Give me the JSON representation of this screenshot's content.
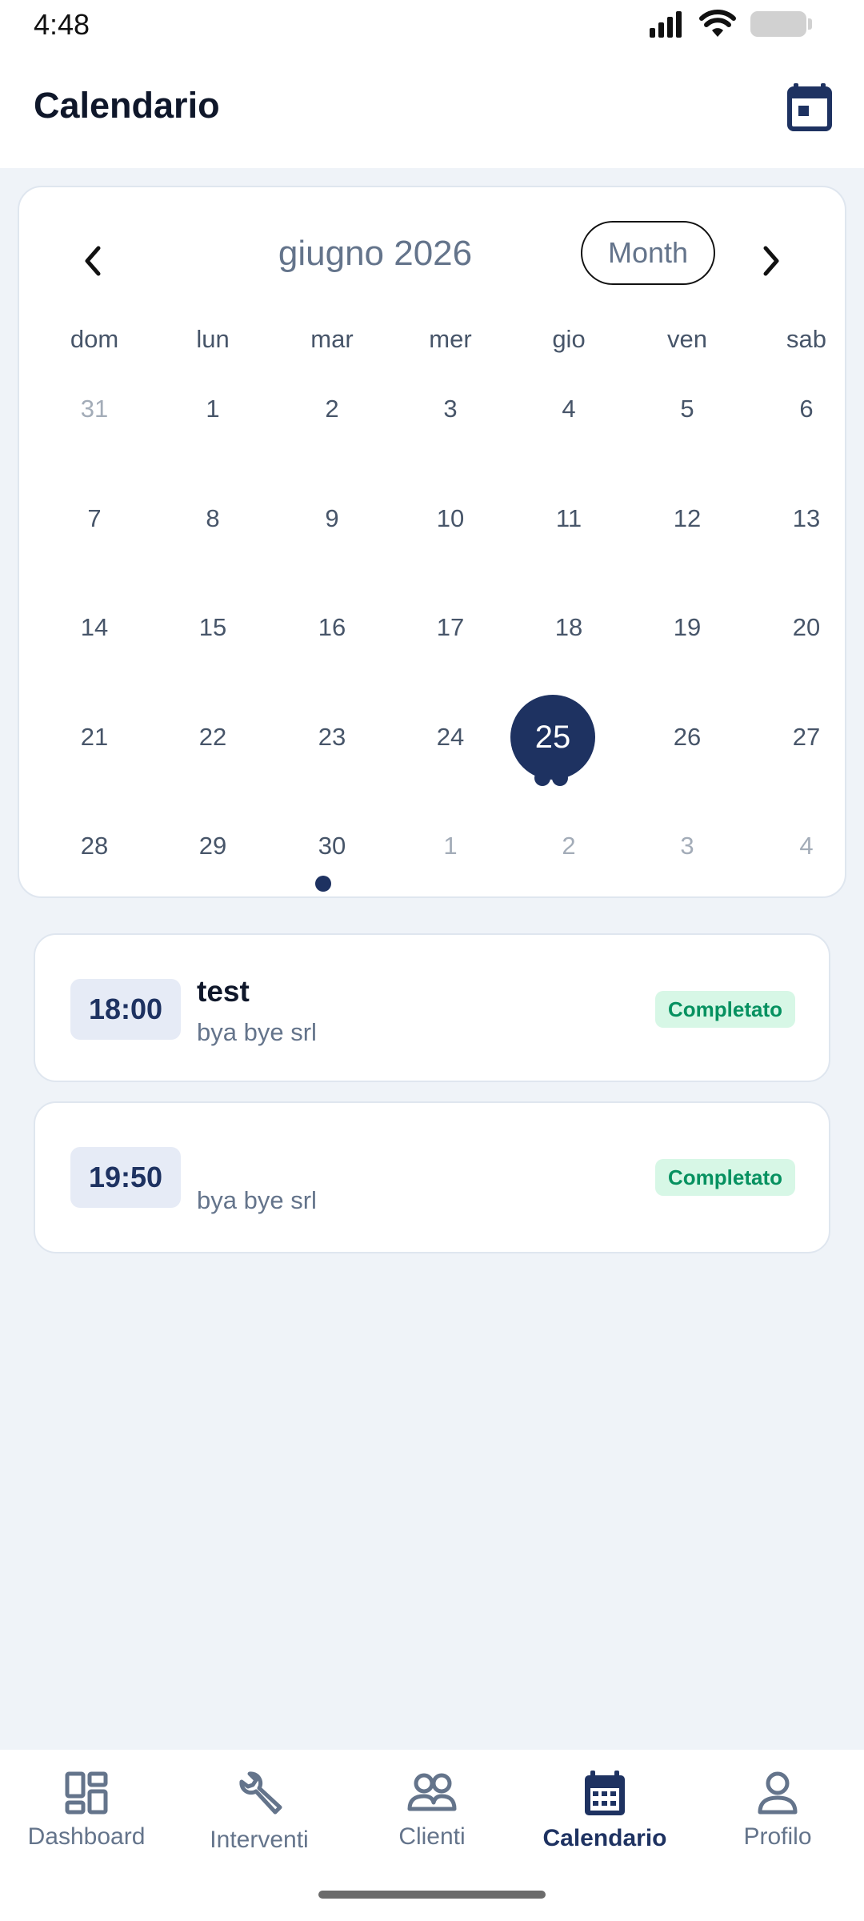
{
  "status_bar": {
    "time": "4:48"
  },
  "header": {
    "title": "Calendario",
    "calendar_icon": "calendar-icon"
  },
  "calendar": {
    "month_label": "giugno 2026",
    "view_button": "Month",
    "weekdays": [
      "dom",
      "lun",
      "mar",
      "mer",
      "gio",
      "ven",
      "sab"
    ],
    "weeks": [
      [
        "31",
        "1",
        "2",
        "3",
        "4",
        "5",
        "6"
      ],
      [
        "7",
        "8",
        "9",
        "10",
        "11",
        "12",
        "13"
      ],
      [
        "14",
        "15",
        "16",
        "17",
        "18",
        "19",
        "20"
      ],
      [
        "21",
        "22",
        "23",
        "24",
        "25",
        "26",
        "27"
      ],
      [
        "28",
        "29",
        "30",
        "1",
        "2",
        "3",
        "4"
      ]
    ],
    "selected_day": "25",
    "accent_color": "#1e3261"
  },
  "events": [
    {
      "time": "18:00",
      "title": "test",
      "client": "bya bye srl",
      "status": "Completato"
    },
    {
      "time": "19:50",
      "title": "",
      "client": "bya bye srl",
      "status": "Completato"
    }
  ],
  "bottom_nav": {
    "items": [
      {
        "label": "Dashboard",
        "icon": "dashboard-icon"
      },
      {
        "label": "Interventi",
        "icon": "wrench-icon"
      },
      {
        "label": "Clienti",
        "icon": "people-icon"
      },
      {
        "label": "Calendario",
        "icon": "calendar-icon",
        "active": true
      },
      {
        "label": "Profilo",
        "icon": "person-icon"
      }
    ]
  }
}
